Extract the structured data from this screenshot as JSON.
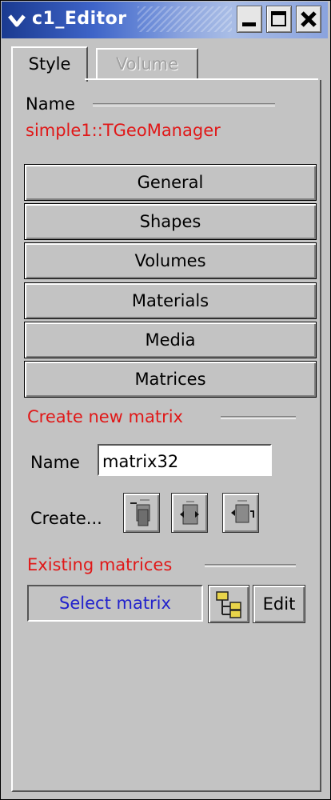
{
  "window": {
    "title": "c1_Editor"
  },
  "tabs": [
    {
      "label": "Style",
      "active": true
    },
    {
      "label": "Volume",
      "active": false
    }
  ],
  "name_section": {
    "label": "Name",
    "value": "simple1::TGeoManager"
  },
  "categories": [
    "General",
    "Shapes",
    "Volumes",
    "Materials",
    "Media",
    "Matrices"
  ],
  "create_matrix": {
    "heading": "Create new matrix",
    "name_label": "Name",
    "name_value": "matrix32",
    "create_label": "Create...",
    "icons": [
      "translation-icon",
      "rotation-icon",
      "combi-transformation-icon"
    ]
  },
  "existing_matrices": {
    "heading": "Existing matrices",
    "select_placeholder": "Select matrix",
    "edit_label": "Edit"
  },
  "colors": {
    "title_bar_start": "#1a3a90",
    "accent_red": "#e01818",
    "select_text_blue": "#2222cc",
    "background": "#c3c3c3"
  }
}
